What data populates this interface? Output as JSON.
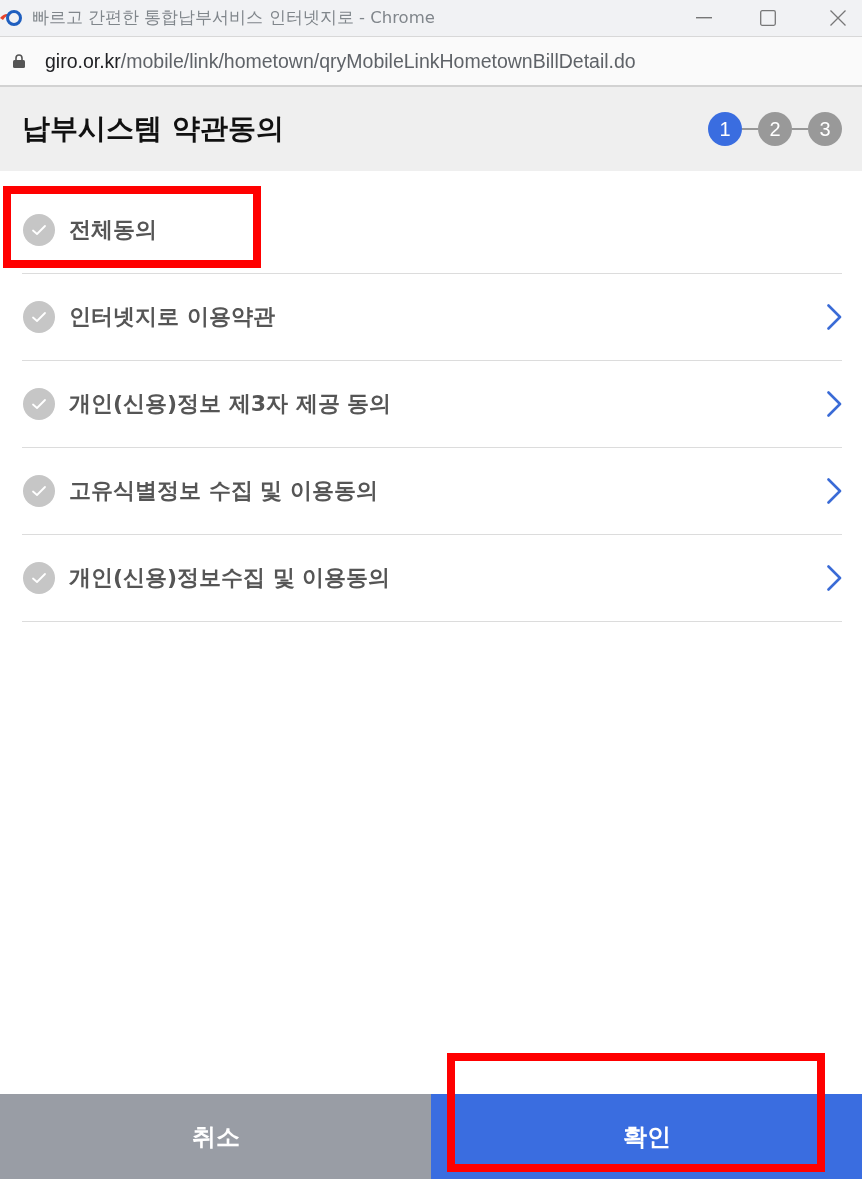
{
  "window": {
    "title": "빠르고 간편한 통합납부서비스 인터넷지로 - Chrome"
  },
  "address_bar": {
    "host": "giro.or.kr",
    "path": "/mobile/link/hometown/qryMobileLinkHometownBillDetail.do"
  },
  "header": {
    "title": "납부시스템 약관동의",
    "steps": [
      {
        "label": "1",
        "selected": true
      },
      {
        "label": "2",
        "selected": false
      },
      {
        "label": "3",
        "selected": false
      }
    ]
  },
  "agree_all": {
    "label": "전체동의",
    "checked": false,
    "highlighted": true
  },
  "terms": [
    {
      "label": "인터넷지로 이용약관",
      "checked": false
    },
    {
      "label": "개인(신용)정보 제3자 제공 동의",
      "checked": false
    },
    {
      "label": "고유식별정보 수집 및 이용동의",
      "checked": false
    },
    {
      "label": "개인(신용)정보수집 및 이용동의",
      "checked": false
    }
  ],
  "buttons": [
    {
      "label": "취소",
      "kind": "cancel",
      "highlighted": false
    },
    {
      "label": "확인",
      "kind": "confirm",
      "highlighted": true
    }
  ]
}
